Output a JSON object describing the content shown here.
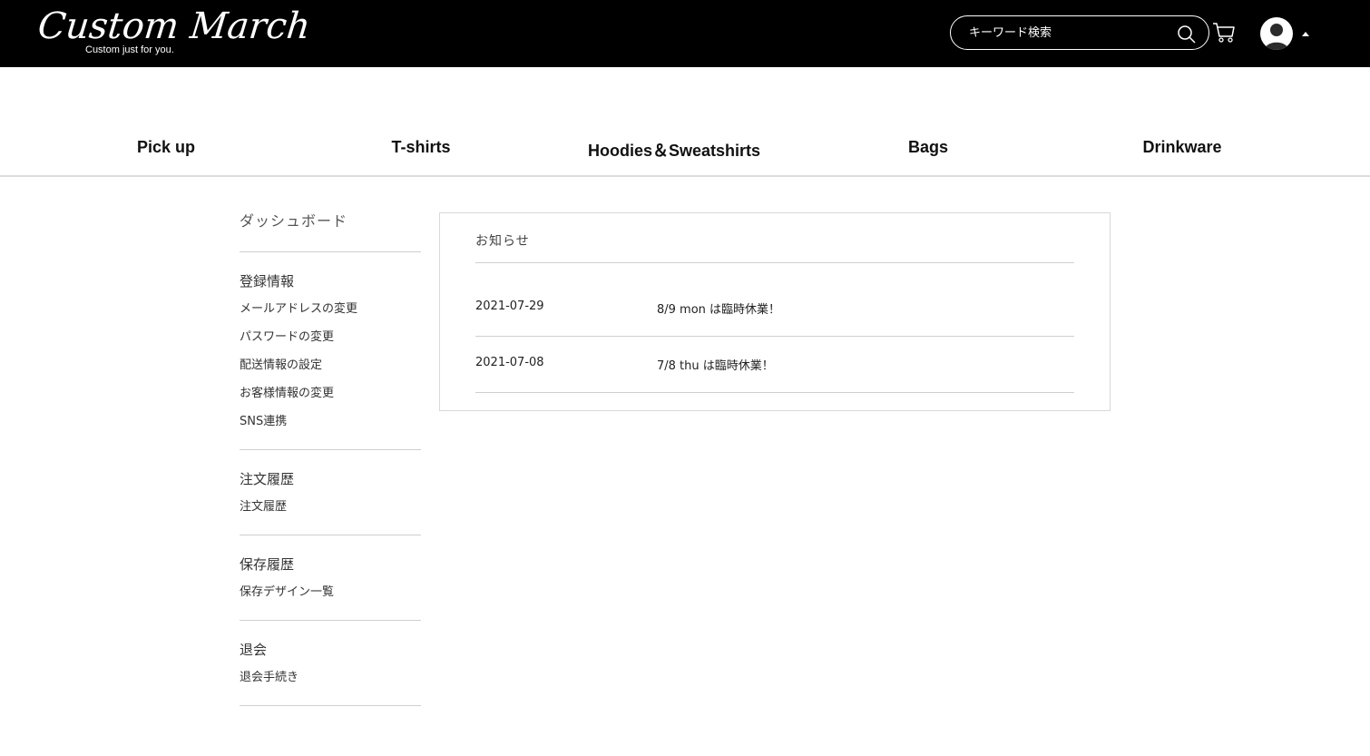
{
  "header": {
    "logo_main": "Custom March",
    "logo_tagline": "Custom just for you.",
    "search_placeholder": "キーワード検索",
    "icons": [
      "search-icon",
      "cart-icon",
      "avatar",
      "caret-up-icon"
    ]
  },
  "categories": [
    "Pick up",
    "T-shirts",
    "Hoodies＆Sweatshirts",
    "Bags",
    "Drinkware"
  ],
  "sidebar": {
    "dashboard": "ダッシュボード",
    "sections": [
      {
        "heading": "登録情報",
        "links": [
          "メールアドレスの変更",
          "パスワードの変更",
          "配送情報の設定",
          "お客様情報の変更",
          "SNS連携"
        ]
      },
      {
        "heading": "注文履歴",
        "links": [
          "注文履歴"
        ]
      },
      {
        "heading": "保存履歴",
        "links": [
          "保存デザイン一覧"
        ]
      },
      {
        "heading": "退会",
        "links": [
          "退会手続き"
        ]
      }
    ]
  },
  "notices": {
    "title": "お知らせ",
    "items": [
      {
        "date": "2021-07-29",
        "text": "8/9 mon は臨時休業！"
      },
      {
        "date": "2021-07-08",
        "text": "7/8 thu は臨時休業！"
      }
    ]
  },
  "colors": {
    "header_bg": "#000000",
    "text": "#222222",
    "divider": "#cfcfcf"
  }
}
